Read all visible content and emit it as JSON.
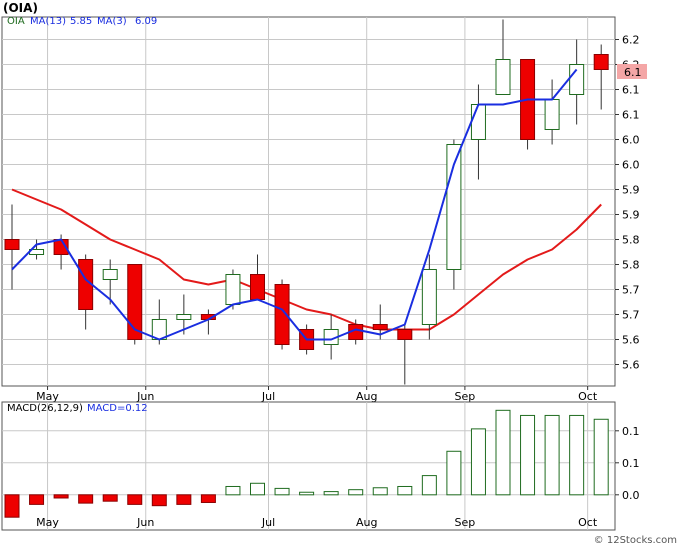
{
  "title": "(OIA)",
  "watermark": "© 12Stocks.com",
  "colors": {
    "up_fill": "#ffffff",
    "up_stroke": "#1f6b1f",
    "down_fill": "#ee0000",
    "down_stroke": "#8b0000",
    "ma13": "#e31a1a",
    "ma3": "#1a2ee0",
    "macd": "#1f6b1f",
    "frame": "#555555",
    "grid": "#c8c8c8",
    "last_price_bg": "#f4a6a6"
  },
  "chart_data": [
    {
      "type": "candlestick",
      "legend": {
        "ticker": "OIA",
        "ma13_label": "MA(13)",
        "ma13_value": "5.85",
        "ma3_label": "MA(3)",
        "ma3_value": "6.09"
      },
      "last_price_label": "6.1",
      "y_ticks": [
        {
          "v": 5.55,
          "label": "5.6"
        },
        {
          "v": 5.6,
          "label": "5.6"
        },
        {
          "v": 5.65,
          "label": "5.7"
        },
        {
          "v": 5.7,
          "label": "5.7"
        },
        {
          "v": 5.75,
          "label": "5.8"
        },
        {
          "v": 5.8,
          "label": "5.8"
        },
        {
          "v": 5.85,
          "label": "5.9"
        },
        {
          "v": 5.9,
          "label": "5.9"
        },
        {
          "v": 5.95,
          "label": "6.0"
        },
        {
          "v": 6.0,
          "label": "6.0"
        },
        {
          "v": 6.05,
          "label": "6.1"
        },
        {
          "v": 6.1,
          "label": "6.1"
        },
        {
          "v": 6.15,
          "label": "6.2"
        },
        {
          "v": 6.2,
          "label": "6.2"
        }
      ],
      "ylim": [
        5.507,
        6.245
      ],
      "x_labels": [
        {
          "label": "May",
          "i": 1
        },
        {
          "label": "Jun",
          "i": 5
        },
        {
          "label": "Jul",
          "i": 10
        },
        {
          "label": "Aug",
          "i": 14
        },
        {
          "label": "Sep",
          "i": 18
        },
        {
          "label": "Oct",
          "i": 23
        }
      ],
      "candles": [
        {
          "o": 5.8,
          "c": 5.78,
          "h": 5.87,
          "l": 5.7
        },
        {
          "o": 5.77,
          "c": 5.78,
          "h": 5.8,
          "l": 5.76
        },
        {
          "o": 5.8,
          "c": 5.77,
          "h": 5.81,
          "l": 5.74
        },
        {
          "o": 5.76,
          "c": 5.66,
          "h": 5.77,
          "l": 5.62
        },
        {
          "o": 5.72,
          "c": 5.74,
          "h": 5.76,
          "l": 5.67
        },
        {
          "o": 5.75,
          "c": 5.6,
          "h": 5.75,
          "l": 5.59
        },
        {
          "o": 5.6,
          "c": 5.64,
          "h": 5.68,
          "l": 5.59
        },
        {
          "o": 5.64,
          "c": 5.65,
          "h": 5.69,
          "l": 5.61
        },
        {
          "o": 5.65,
          "c": 5.64,
          "h": 5.66,
          "l": 5.61
        },
        {
          "o": 5.67,
          "c": 5.73,
          "h": 5.74,
          "l": 5.66
        },
        {
          "o": 5.73,
          "c": 5.68,
          "h": 5.77,
          "l": 5.68
        },
        {
          "o": 5.71,
          "c": 5.59,
          "h": 5.72,
          "l": 5.58
        },
        {
          "o": 5.62,
          "c": 5.58,
          "h": 5.63,
          "l": 5.57
        },
        {
          "o": 5.59,
          "c": 5.62,
          "h": 5.65,
          "l": 5.56
        },
        {
          "o": 5.63,
          "c": 5.6,
          "h": 5.64,
          "l": 5.59
        },
        {
          "o": 5.63,
          "c": 5.62,
          "h": 5.67,
          "l": 5.6
        },
        {
          "o": 5.62,
          "c": 5.6,
          "h": 5.63,
          "l": 5.51
        },
        {
          "o": 5.63,
          "c": 5.74,
          "h": 5.77,
          "l": 5.6
        },
        {
          "o": 5.74,
          "c": 5.99,
          "h": 6.0,
          "l": 5.7
        },
        {
          "o": 6.0,
          "c": 6.07,
          "h": 6.11,
          "l": 5.92
        },
        {
          "o": 6.09,
          "c": 6.16,
          "h": 6.24,
          "l": 6.09
        },
        {
          "o": 6.16,
          "c": 6.0,
          "h": 6.16,
          "l": 5.98
        },
        {
          "o": 6.02,
          "c": 6.08,
          "h": 6.12,
          "l": 5.99
        },
        {
          "o": 6.09,
          "c": 6.15,
          "h": 6.2,
          "l": 6.03
        },
        {
          "o": 6.17,
          "c": 6.14,
          "h": 6.19,
          "l": 6.06
        }
      ],
      "ma13": [
        5.9,
        5.88,
        5.86,
        5.83,
        5.8,
        5.78,
        5.76,
        5.72,
        5.71,
        5.72,
        5.7,
        5.68,
        5.66,
        5.65,
        5.63,
        5.62,
        5.62,
        5.62,
        5.65,
        5.69,
        5.73,
        5.76,
        5.78,
        5.82,
        5.87
      ],
      "ma3": [
        5.74,
        5.79,
        5.8,
        5.72,
        5.68,
        5.62,
        5.6,
        5.62,
        5.64,
        5.67,
        5.68,
        5.66,
        5.6,
        5.6,
        5.62,
        5.61,
        5.63,
        5.78,
        5.95,
        6.07,
        6.07,
        6.08,
        6.08,
        6.14
      ]
    },
    {
      "type": "bar",
      "legend": {
        "label": "MACD(26,12,9)",
        "value_label": "MACD=0.12"
      },
      "y_ticks": [
        {
          "v": 0.0,
          "label": "0.0"
        },
        {
          "v": 0.05,
          "label": "0.1"
        },
        {
          "v": 0.1,
          "label": "0.1"
        }
      ],
      "ylim": [
        -0.055,
        0.145
      ],
      "x_labels": [
        "May",
        "Jun",
        "Jul",
        "Aug",
        "Sep",
        "Oct"
      ],
      "values": [
        -0.035,
        -0.015,
        -0.005,
        -0.013,
        -0.01,
        -0.015,
        -0.017,
        -0.015,
        -0.012,
        0.013,
        0.018,
        0.01,
        0.004,
        0.005,
        0.008,
        0.011,
        0.013,
        0.03,
        0.068,
        0.103,
        0.132,
        0.124,
        0.124,
        0.124,
        0.118
      ]
    }
  ]
}
